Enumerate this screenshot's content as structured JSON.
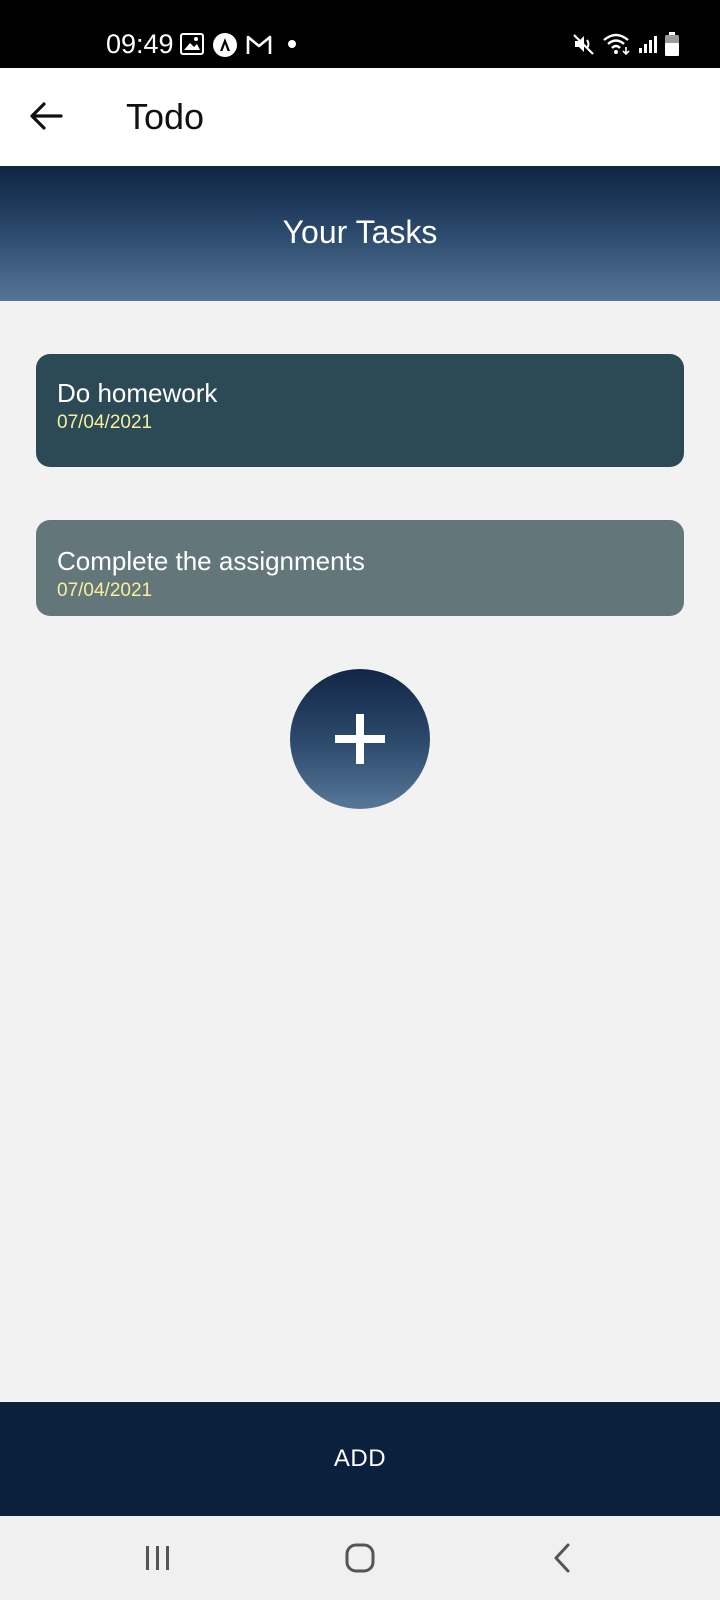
{
  "status_bar": {
    "time": "09:49",
    "icons": [
      "image-icon",
      "assistant-icon",
      "gmail-icon",
      "dot-icon",
      "mute-icon",
      "wifi-icon",
      "signal-icon",
      "battery-icon"
    ]
  },
  "app_bar": {
    "title": "Todo",
    "back_icon": "arrow-left-icon"
  },
  "banner": {
    "title": "Your Tasks"
  },
  "tasks": [
    {
      "title": "Do homework",
      "date": "07/04/2021"
    },
    {
      "title": "Complete the assignments",
      "date": "07/04/2021"
    }
  ],
  "fab": {
    "icon": "plus-icon"
  },
  "add_bar": {
    "label": "ADD"
  },
  "nav_bar": {
    "icons": [
      "recents-icon",
      "home-icon",
      "back-icon"
    ]
  },
  "colors": {
    "banner_top": "#0f2443",
    "banner_bottom": "#557596",
    "task_dark": "#2b4a55",
    "task_light": "#63777b",
    "task_date": "#f7ef9a",
    "add_bar": "#0b203d",
    "background": "#f2f2f2"
  }
}
